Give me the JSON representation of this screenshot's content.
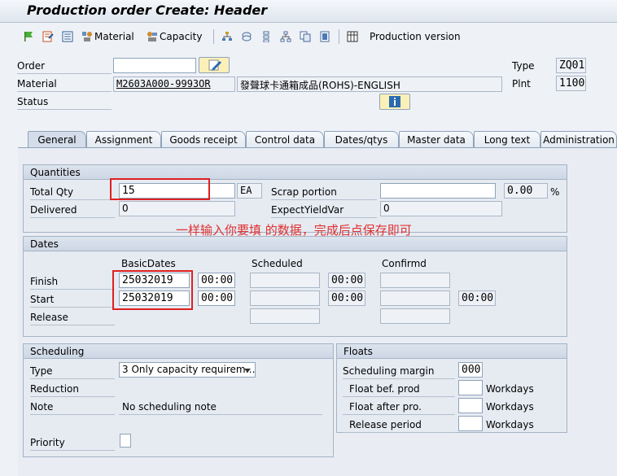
{
  "window": {
    "title": "Production order Create: Header"
  },
  "toolbar": {
    "material_label": "Material",
    "capacity_label": "Capacity",
    "production_version_label": "Production version"
  },
  "header": {
    "order_label": "Order",
    "order_value": "",
    "material_label": "Material",
    "material_value": "M2603A000-9993OR",
    "material_desc": "發聲球卡通箱成品(ROHS)-ENGLISH",
    "status_label": "Status",
    "type_label": "Type",
    "type_value": "ZQ01",
    "plnt_label": "Plnt",
    "plnt_value": "1100"
  },
  "tabs": [
    {
      "label": "General"
    },
    {
      "label": "Assignment"
    },
    {
      "label": "Goods receipt"
    },
    {
      "label": "Control data"
    },
    {
      "label": "Dates/qtys"
    },
    {
      "label": "Master data"
    },
    {
      "label": "Long text"
    },
    {
      "label": "Administration"
    }
  ],
  "quantities": {
    "title": "Quantities",
    "total_qty_label": "Total Qty",
    "total_qty_value": "15",
    "unit": "EA",
    "scrap_label": "Scrap portion",
    "scrap_value": "",
    "scrap_pct": "0.00",
    "pct_sign": "%",
    "delivered_label": "Delivered",
    "delivered_value": "0",
    "expect_label": "ExpectYieldVar",
    "expect_value": "0"
  },
  "annotation": "一样输入你要填 的数据，完成后点保存即可",
  "dates": {
    "title": "Dates",
    "col_basic": "BasicDates",
    "col_scheduled": "Scheduled",
    "col_confirmed": "Confirmd",
    "finish_label": "Finish",
    "start_label": "Start",
    "release_label": "Release",
    "finish_date": "25032019",
    "finish_time": "00:00",
    "finish_sched_time": "00:00",
    "start_date": "25032019",
    "start_time": "00:00",
    "start_sched_time": "00:00",
    "start_conf_time": "00:00"
  },
  "scheduling": {
    "title": "Scheduling",
    "type_label": "Type",
    "type_value": "3 Only capacity requirem…",
    "reduction_label": "Reduction",
    "note_label": "Note",
    "note_value": "No scheduling note",
    "priority_label": "Priority"
  },
  "floats": {
    "title": "Floats",
    "margin_label": "Scheduling margin",
    "margin_value": "000",
    "bef_label": "Float bef. prod",
    "after_label": "Float after pro.",
    "release_label": "Release period",
    "unit": "Workdays"
  },
  "colors": {
    "accent": "#e02020",
    "annotation": "#e03030"
  }
}
